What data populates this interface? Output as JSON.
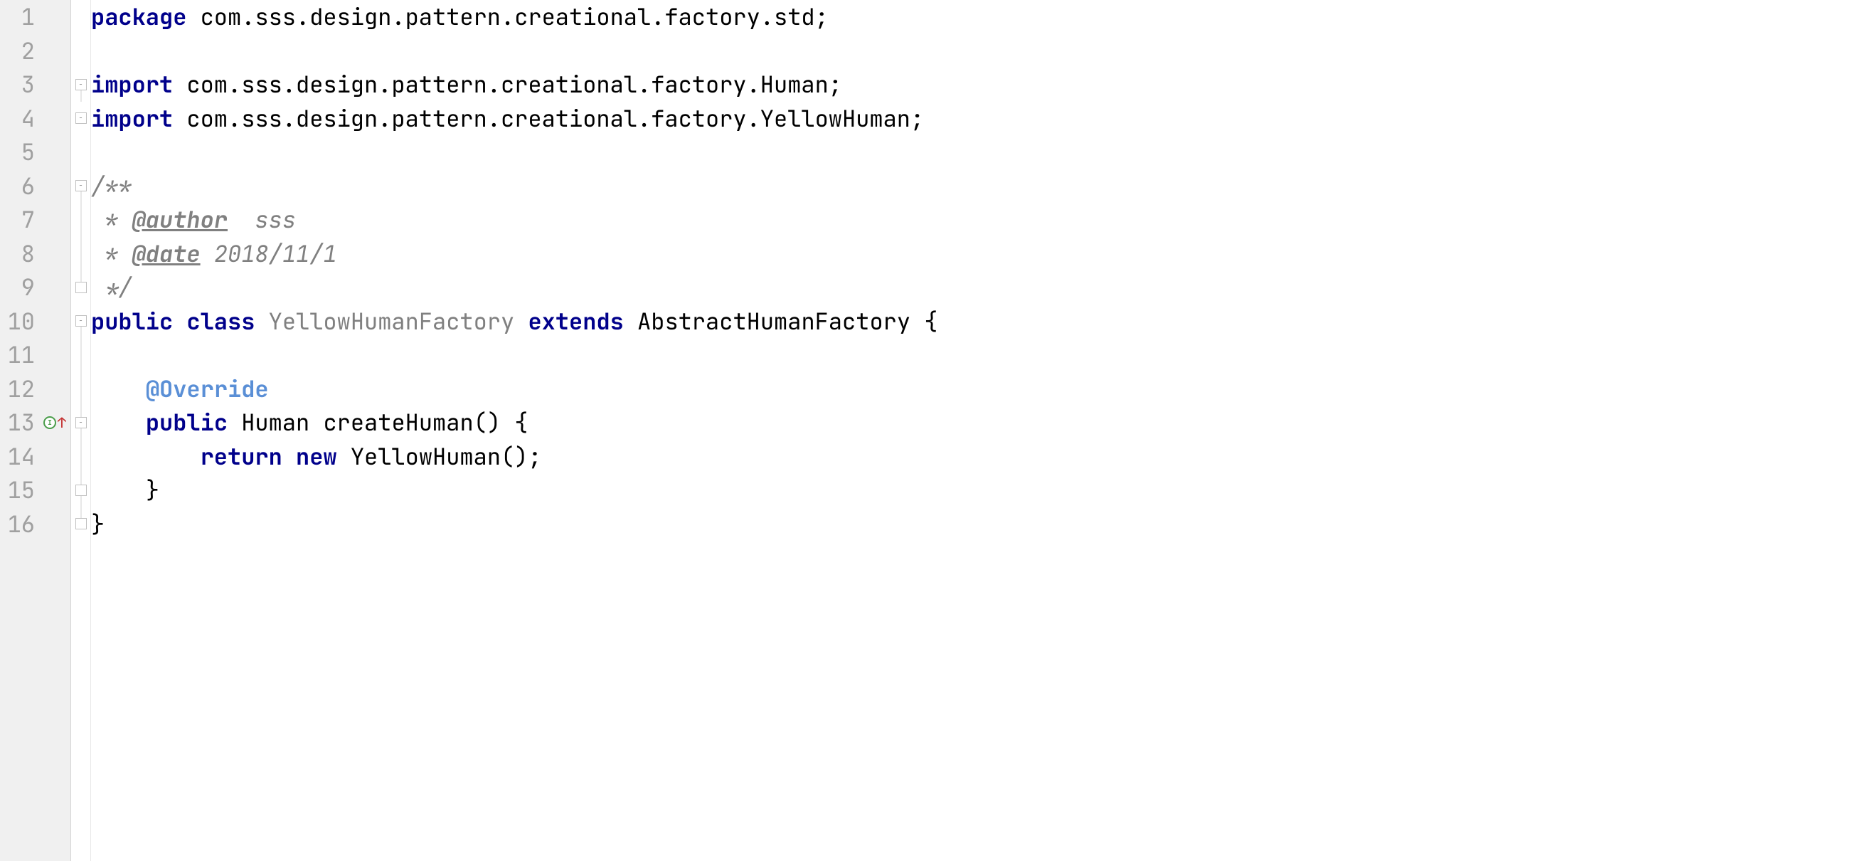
{
  "lines": {
    "n1": "1",
    "n2": "2",
    "n3": "3",
    "n4": "4",
    "n5": "5",
    "n6": "6",
    "n7": "7",
    "n8": "8",
    "n9": "9",
    "n10": "10",
    "n11": "11",
    "n12": "12",
    "n13": "13",
    "n14": "14",
    "n15": "15",
    "n16": "16"
  },
  "code": {
    "kw_package": "package",
    "pkg": " com.sss.design.pattern.creational.factory.std;",
    "kw_import1": "import",
    "imp1": " com.sss.design.pattern.creational.factory.Human;",
    "kw_import2": "import",
    "imp2": " com.sss.design.pattern.creational.factory.YellowHuman;",
    "doc_open": "/**",
    "doc_star1": " * ",
    "doc_tag_author": "@author",
    "doc_author_val": "  sss",
    "doc_star2": " * ",
    "doc_tag_date": "@date",
    "doc_date_val": " 2018/11/1",
    "doc_close": " */",
    "kw_public1": "public",
    "kw_class": "class",
    "class_name": "YellowHumanFactory",
    "kw_extends": "extends",
    "super_name": "AbstractHumanFactory",
    "brace_open1": " {",
    "annotation_override": "@Override",
    "kw_public2": "public",
    "ret_type": "Human",
    "method_name": "createHuman",
    "method_sig": "() {",
    "kw_return": "return",
    "kw_new": "new",
    "ctor": "YellowHuman",
    "ctor_tail": "();",
    "brace_close_m": "}",
    "brace_close_c": "}"
  },
  "indent": {
    "lvl1": "    ",
    "lvl2": "        "
  },
  "fold": {
    "minus": "−"
  },
  "icons": {
    "impl": "I"
  }
}
